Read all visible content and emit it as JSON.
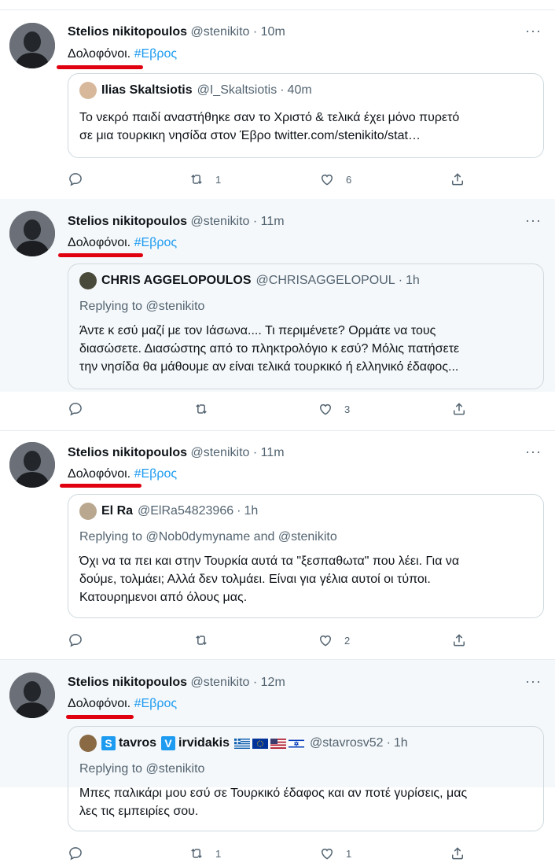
{
  "tweets": [
    {
      "author": "Stelios nikitopoulos",
      "handle": "@stenikito",
      "time": "10m",
      "more": "···",
      "text": "Δολοφόνοι.",
      "hashtag": "#Εβρος",
      "quote": {
        "name": "Ilias Skaltsiotis",
        "handle": "@I_Skaltsiotis",
        "time": "40m",
        "replying": "",
        "lines": [
          "Το νεκρό παιδί αναστήθηκε σαν το Χριστό & τελικά έχει μόνο πυρετό",
          "σε μια τουρκικη νησίδα στον Έβρο twitter.com/stenikito/stat…"
        ]
      },
      "retweets": "1",
      "likes": "6"
    },
    {
      "author": "Stelios nikitopoulos",
      "handle": "@stenikito",
      "time": "11m",
      "more": "···",
      "text": "Δολοφόνοι.",
      "hashtag": "#Εβρος",
      "quote": {
        "name": "CHRIS AGGELOPOULOS",
        "handle": "@CHRISAGGELOPOUL",
        "time": "1h",
        "replying": "Replying to @stenikito",
        "lines": [
          "Άντε κ εσύ μαζί με τον Ιάσωνα.... Τι περιμένετε? Ορμάτε να τους",
          "διασώσετε. Διασώστης από το πληκτρολόγιο κ εσύ? Μόλις πατήσετε",
          "την νησίδα θα μάθουμε αν είναι τελικά τουρκικό ή ελληνικό έδαφος..."
        ]
      },
      "retweets": "",
      "likes": "3"
    },
    {
      "author": "Stelios nikitopoulos",
      "handle": "@stenikito",
      "time": "11m",
      "more": "···",
      "text": "Δολοφόνοι.",
      "hashtag": "#Εβρος",
      "quote": {
        "name": "El Ra",
        "handle": "@ElRa54823966",
        "time": "1h",
        "replying": "Replying to @Nob0dymyname and @stenikito",
        "lines": [
          "Όχι να τα πει και στην Τουρκία αυτά τα \"ξεσπαθωτα\" που λέει. Για να",
          "δούμε, τολμάει; Αλλά δεν τολμάει. Είναι για γέλια αυτοί οι τύποι.",
          "Κατουρημενοι από όλους μας."
        ]
      },
      "retweets": "",
      "likes": "2"
    },
    {
      "author": "Stelios nikitopoulos",
      "handle": "@stenikito",
      "time": "12m",
      "more": "···",
      "text": "Δολοφόνοι.",
      "hashtag": "#Εβρος",
      "quote": {
        "name_badge1": "S",
        "name_part1": "tavros",
        "name_badge2": "V",
        "name_part2": "irvidakis",
        "handle": "@stavrosv52",
        "time": "1h",
        "replying": "Replying to @stenikito",
        "lines": [
          "Μπες παλικάρι μου εσύ σε Τουρκικό έδαφος και αν ποτέ γυρίσεις,  μας",
          "λες τις εμπειρίες σου."
        ]
      },
      "retweets": "1",
      "likes": "1"
    }
  ],
  "dot": "·",
  "colors": {
    "accent": "#1d9bf0",
    "underline": "#e0000f",
    "highlight": "#f5f8fa"
  }
}
